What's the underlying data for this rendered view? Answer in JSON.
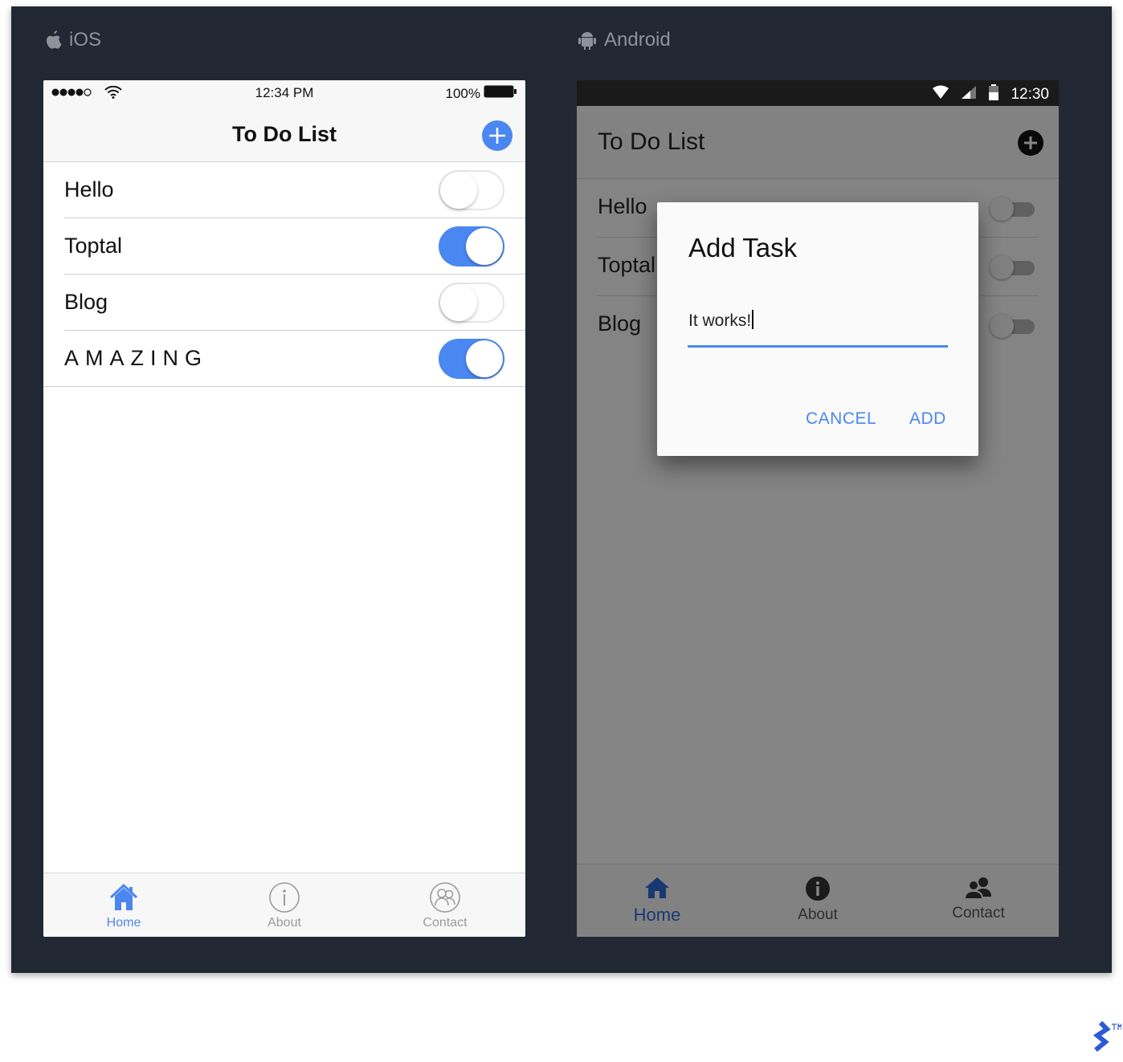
{
  "platforms": {
    "ios_label": "iOS",
    "android_label": "Android"
  },
  "ios": {
    "status": {
      "time": "12:34 PM",
      "battery": "100%"
    },
    "nav_title": "To Do List",
    "items": [
      {
        "label": "Hello",
        "on": false
      },
      {
        "label": "Toptal",
        "on": true
      },
      {
        "label": "Blog",
        "on": false
      },
      {
        "label": "AMAZING",
        "on": true
      }
    ],
    "tabs": [
      {
        "label": "Home",
        "icon": "home-icon",
        "active": true
      },
      {
        "label": "About",
        "icon": "info-icon",
        "active": false
      },
      {
        "label": "Contact",
        "icon": "contacts-icon",
        "active": false
      }
    ],
    "accent": "#4a87f0"
  },
  "android": {
    "status": {
      "time": "12:30"
    },
    "app_title": "To Do List",
    "items": [
      {
        "label": "Hello",
        "on": false
      },
      {
        "label": "Toptal",
        "on": false
      },
      {
        "label": "Blog",
        "on": false
      }
    ],
    "dialog": {
      "title": "Add Task",
      "input_value": "It works!",
      "cancel_label": "CANCEL",
      "add_label": "ADD"
    },
    "tabs": [
      {
        "label": "Home",
        "icon": "home-icon",
        "active": true
      },
      {
        "label": "About",
        "icon": "info-icon",
        "active": false
      },
      {
        "label": "Contact",
        "icon": "contacts-icon",
        "active": false
      }
    ],
    "accent": "#2f6bd6"
  }
}
